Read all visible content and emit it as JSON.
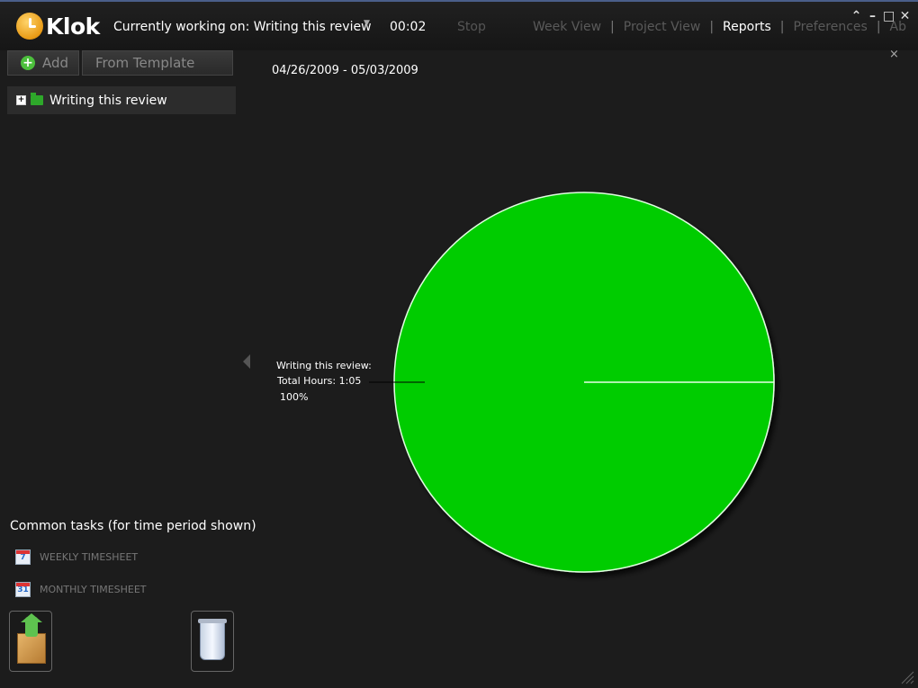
{
  "app": {
    "name": "Klok"
  },
  "header": {
    "working_label": "Currently working on: Writing this review",
    "timer": "00:02",
    "stop_label": "Stop",
    "nav": [
      {
        "label": "Week View",
        "active": false
      },
      {
        "label": "Project View",
        "active": false
      },
      {
        "label": "Reports",
        "active": true
      },
      {
        "label": "Preferences",
        "active": false
      },
      {
        "label": "Ab",
        "active": false
      }
    ]
  },
  "toolbar": {
    "add_label": "Add",
    "template_label": "From Template"
  },
  "projects": [
    {
      "label": "Writing this review",
      "color": "#2ea82a"
    }
  ],
  "report": {
    "date_range": "04/26/2009 - 05/03/2009",
    "close_label": "×"
  },
  "common_tasks": {
    "title": "Common tasks (for time period shown)",
    "items": [
      {
        "label": "WEEKLY TIMESHEET",
        "icon": "calendar-7-icon",
        "icon_text": "7"
      },
      {
        "label": "MONTHLY TIMESHEET",
        "icon": "calendar-31-icon",
        "icon_text": "31"
      }
    ]
  },
  "chart_data": {
    "type": "pie",
    "slices": [
      {
        "name": "Writing this review:",
        "total_label": "Total Hours: 1:05",
        "value": 100,
        "pct_label": "100%",
        "color": "#00cc00"
      }
    ]
  }
}
